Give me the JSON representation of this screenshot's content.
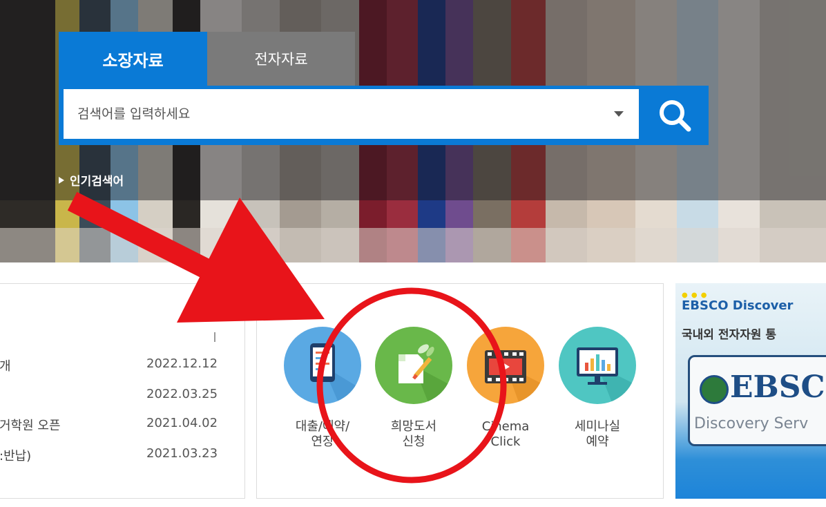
{
  "search": {
    "tabs": [
      {
        "label": "소장자료",
        "active": true
      },
      {
        "label": "전자자료",
        "active": false
      }
    ],
    "placeholder": "검색어를 입력하세요",
    "popular_label": "인기검색어"
  },
  "notices": [
    {
      "title": "개",
      "date": "2022.12.12"
    },
    {
      "title": "",
      "date": "2022.03.25"
    },
    {
      "title": "거학원 오픈",
      "date": "2021.04.02"
    },
    {
      "title": ":반납)",
      "date": "2021.03.23"
    }
  ],
  "quick_menu": [
    {
      "line1": "대출/예약/",
      "line2": "연장",
      "icon": "tablet-icon",
      "color": "#5aa9e3"
    },
    {
      "line1": "희망도서",
      "line2": "신청",
      "icon": "document-pen-icon",
      "color": "#69b84a"
    },
    {
      "line1": "Cinema",
      "line2": "Click",
      "icon": "film-icon",
      "color": "#f6a53b"
    },
    {
      "line1": "세미나실",
      "line2": "예약",
      "icon": "monitor-chart-icon",
      "color": "#4fc6c2"
    }
  ],
  "ebsco": {
    "title": "EBSCO Discover",
    "subtitle": "국내외 전자자원 통",
    "logo": "EBSC",
    "tagline": "Discovery Serv"
  },
  "colors": {
    "primary_blue": "#0a7ad6",
    "inactive_tab": "#7a7a7a",
    "annotation_red": "#e8141a"
  }
}
